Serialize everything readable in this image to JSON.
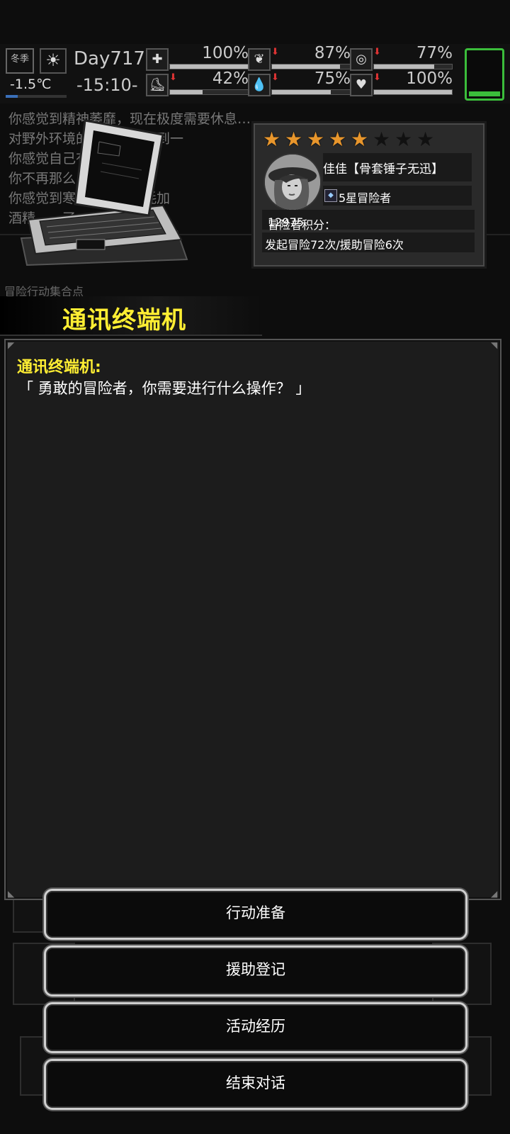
{
  "status": {
    "season": "冬季",
    "temperature": "-1.5℃",
    "temperature_level": 0.2,
    "day": "Day717",
    "time": "-15:10-",
    "stats": [
      {
        "icon": "medkit-icon",
        "glyph": "✚",
        "value": "100%",
        "level": 1.0,
        "down": false
      },
      {
        "icon": "stomach-icon",
        "glyph": "❦",
        "value": "87%",
        "level": 0.87,
        "down": true
      },
      {
        "icon": "mask-icon",
        "glyph": "◎",
        "value": "77%",
        "level": 0.77,
        "down": true
      },
      {
        "icon": "boot-icon",
        "glyph": "⛸",
        "value": "42%",
        "level": 0.42,
        "down": true
      },
      {
        "icon": "water-drop-icon",
        "glyph": "💧",
        "value": "75%",
        "level": 0.75,
        "down": true
      },
      {
        "icon": "heart-icon",
        "glyph": "♥",
        "value": "100%",
        "level": 1.0,
        "down": true
      }
    ],
    "battery_level": 0.12
  },
  "log": [
    "你感觉到精神萎靡，现在极度需要休息……",
    "对野外环境的恐惧让你感到一",
    "你感觉自己有些饥饿……",
    "你不再那么……",
    "你感觉到寒冷与饱食消耗加",
    "酒精……了……"
  ],
  "location_label": "冒险行动集合点",
  "profile": {
    "stars_total": 8,
    "stars_filled": 5,
    "name": "佳佳【骨套锤子无迅】",
    "rank": "5星冒险者",
    "score_label": "冒险者积分：",
    "score": "12975",
    "adventures": "发起冒险72次/援助冒险6次"
  },
  "title": "通讯终端机",
  "dialog": {
    "speaker": "通讯终端机:",
    "text": "「 勇敢的冒险者，你需要进行什么操作？ 」"
  },
  "buttons": [
    "行动准备",
    "援助登记",
    "活动经历",
    "结束对话"
  ]
}
